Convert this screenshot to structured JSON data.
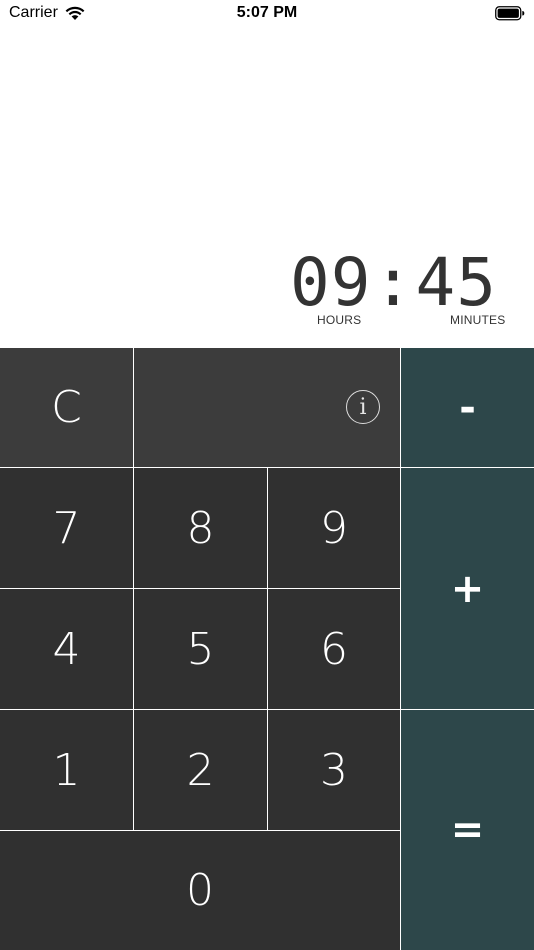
{
  "status_bar": {
    "carrier": "Carrier",
    "time": "5:07 PM",
    "wifi_icon": "wifi-icon",
    "battery_icon": "battery-icon"
  },
  "display": {
    "hours": "09",
    "separator": ":",
    "minutes": "45",
    "hours_label": "HOURS",
    "minutes_label": "MINUTES"
  },
  "keypad": {
    "clear": "C",
    "info_icon": "info-icon",
    "info_glyph": "i",
    "minus": "-",
    "plus": "+",
    "equals": "=",
    "digits": {
      "seven": "7",
      "eight": "8",
      "nine": "9",
      "four": "4",
      "five": "5",
      "six": "6",
      "one": "1",
      "two": "2",
      "three": "3",
      "zero": "0"
    }
  },
  "colors": {
    "key_dark": "#303030",
    "key_mid": "#3c3c3c",
    "key_operator": "#2d474a",
    "display_text": "#333333"
  }
}
